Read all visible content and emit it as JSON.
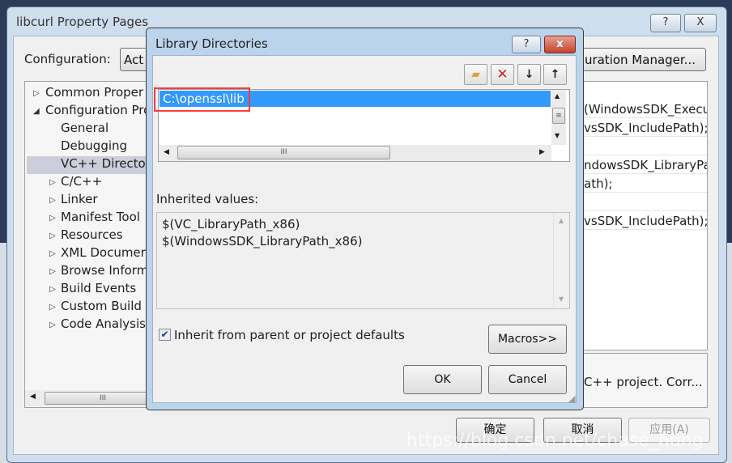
{
  "main_window": {
    "title": "libcurl Property Pages",
    "help_glyph": "?",
    "close_glyph": "X",
    "configuration_label": "Configuration:",
    "configuration_value": "Act",
    "config_manager_label": "guration Manager...",
    "tree": [
      {
        "label": "Common Proper",
        "expander": "collapsed",
        "level": 0
      },
      {
        "label": "Configuration Pro",
        "expander": "expanded",
        "level": 0
      },
      {
        "label": "General",
        "expander": "none",
        "level": 1
      },
      {
        "label": "Debugging",
        "expander": "none",
        "level": 1
      },
      {
        "label": "VC++ Director",
        "expander": "none",
        "level": 1,
        "selected": true
      },
      {
        "label": "C/C++",
        "expander": "collapsed",
        "level": 1
      },
      {
        "label": "Linker",
        "expander": "collapsed",
        "level": 1
      },
      {
        "label": "Manifest Tool",
        "expander": "collapsed",
        "level": 1
      },
      {
        "label": "Resources",
        "expander": "collapsed",
        "level": 1
      },
      {
        "label": "XML Documer",
        "expander": "collapsed",
        "level": 1
      },
      {
        "label": "Browse Inform",
        "expander": "collapsed",
        "level": 1
      },
      {
        "label": "Build Events",
        "expander": "collapsed",
        "level": 1
      },
      {
        "label": "Custom Build S",
        "expander": "collapsed",
        "level": 1
      },
      {
        "label": "Code Analysis",
        "expander": "collapsed",
        "level": 1
      }
    ],
    "grid_rows": [
      "(WindowsSDK_Execu",
      "vsSDK_IncludePath);",
      "",
      "ndowsSDK_LibraryPat",
      "ath);",
      "",
      "vsSDK_IncludePath);$"
    ],
    "description": "C++ project.  Corr...",
    "ok_label": "确定",
    "cancel_label": "取消",
    "apply_label": "应用(A)"
  },
  "dialog": {
    "title": "Library Directories",
    "help_glyph": "?",
    "close_glyph": "x",
    "toolbar": [
      {
        "name": "new-folder",
        "glyph": "📁"
      },
      {
        "name": "delete",
        "glyph": "✕"
      },
      {
        "name": "move-down",
        "glyph": "↓"
      },
      {
        "name": "move-up",
        "glyph": "↑"
      }
    ],
    "entries": [
      "C:\\openssl\\lib"
    ],
    "inherited_label": "Inherited values:",
    "inherited_values": [
      "$(VC_LibraryPath_x86)",
      "$(WindowsSDK_LibraryPath_x86)"
    ],
    "inherit_checkbox_label": "Inherit from parent or project defaults",
    "inherit_checked": true,
    "macros_label": "Macros>>",
    "ok_label": "OK",
    "cancel_label": "Cancel"
  },
  "colors": {
    "selection": "#3399ff",
    "highlight_box": "#ff3b3b",
    "tree_selected": "#cccedb"
  },
  "watermark": "https://blog.csdn.net/chase_hung"
}
